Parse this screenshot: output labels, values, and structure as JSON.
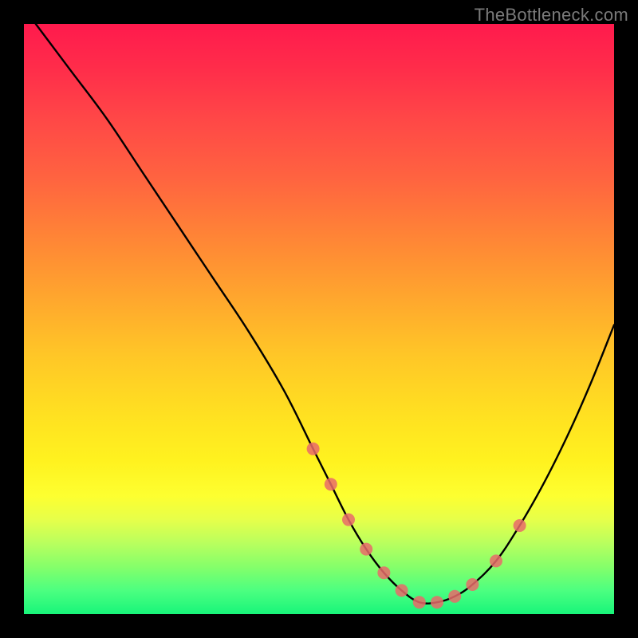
{
  "watermark": "TheBottleneck.com",
  "chart_data": {
    "type": "line",
    "title": "",
    "xlabel": "",
    "ylabel": "",
    "xlim": [
      0,
      100
    ],
    "ylim": [
      0,
      100
    ],
    "grid": false,
    "legend": false,
    "series": [
      {
        "name": "bottleneck-curve",
        "color": "#000000",
        "x": [
          2,
          8,
          14,
          20,
          26,
          32,
          38,
          44,
          49,
          52,
          55,
          58,
          61,
          64,
          67,
          70,
          73,
          76,
          80,
          84,
          88,
          92,
          96,
          100
        ],
        "y": [
          100,
          92,
          84,
          75,
          66,
          57,
          48,
          38,
          28,
          22,
          16,
          11,
          7,
          4,
          2,
          2,
          3,
          5,
          9,
          15,
          22,
          30,
          39,
          49
        ]
      }
    ],
    "highlight_points": {
      "name": "bottom-cluster",
      "color": "#e96a6a",
      "radius": 8,
      "x": [
        49,
        52,
        55,
        58,
        61,
        64,
        67,
        70,
        73,
        76,
        80,
        84
      ],
      "y": [
        28,
        22,
        16,
        11,
        7,
        4,
        2,
        2,
        3,
        5,
        9,
        15
      ]
    }
  }
}
